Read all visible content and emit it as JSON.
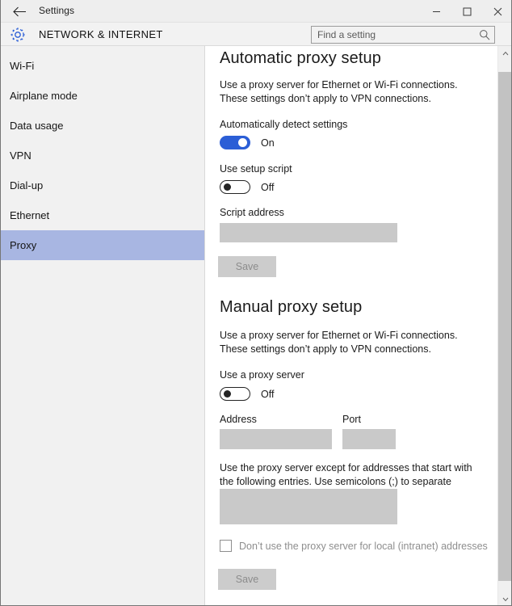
{
  "window": {
    "title": "Settings",
    "back_icon": "back-arrow-icon",
    "minimize_label": "Minimize",
    "maximize_label": "Maximize",
    "close_label": "Close"
  },
  "header": {
    "icon": "gear-icon",
    "title": "NETWORK & INTERNET",
    "search": {
      "placeholder": "Find a setting",
      "value": "",
      "icon": "search-icon"
    }
  },
  "sidebar": {
    "items": [
      {
        "label": "Wi-Fi",
        "selected": false
      },
      {
        "label": "Airplane mode",
        "selected": false
      },
      {
        "label": "Data usage",
        "selected": false
      },
      {
        "label": "VPN",
        "selected": false
      },
      {
        "label": "Dial-up",
        "selected": false
      },
      {
        "label": "Ethernet",
        "selected": false
      },
      {
        "label": "Proxy",
        "selected": true
      }
    ],
    "selected_color": "#a8b6e2"
  },
  "automatic_proxy": {
    "heading": "Automatic proxy setup",
    "description": "Use a proxy server for Ethernet or Wi-Fi connections. These settings don’t apply to VPN connections.",
    "auto_detect": {
      "label": "Automatically detect settings",
      "state": "On",
      "on": true
    },
    "setup_script": {
      "label": "Use setup script",
      "state": "Off",
      "on": false
    },
    "script_address": {
      "label": "Script address",
      "value": "",
      "disabled": true
    },
    "save_label": "Save"
  },
  "manual_proxy": {
    "heading": "Manual proxy setup",
    "description": "Use a proxy server for Ethernet or Wi-Fi connections. These settings don’t apply to VPN connections.",
    "use_proxy": {
      "label": "Use a proxy server",
      "state": "Off",
      "on": false
    },
    "address": {
      "label": "Address",
      "value": "",
      "disabled": true
    },
    "port": {
      "label": "Port",
      "value": "",
      "disabled": true
    },
    "exceptions": {
      "description": "Use the proxy server except for addresses that start with the following entries. Use semicolons (;) to separate entries.",
      "value": "",
      "disabled": true
    },
    "bypass_local": {
      "label": "Don’t use the proxy server for local (intranet) addresses",
      "checked": false
    },
    "save_label": "Save"
  },
  "scrollbar": {
    "up_icon": "chevron-up-icon",
    "down_icon": "chevron-down-icon"
  },
  "colors": {
    "accent_blue": "#2b5ed6",
    "selection": "#a8b6e2",
    "disabled_field": "#c9c9c9",
    "disabled_button": "#cccccc"
  }
}
